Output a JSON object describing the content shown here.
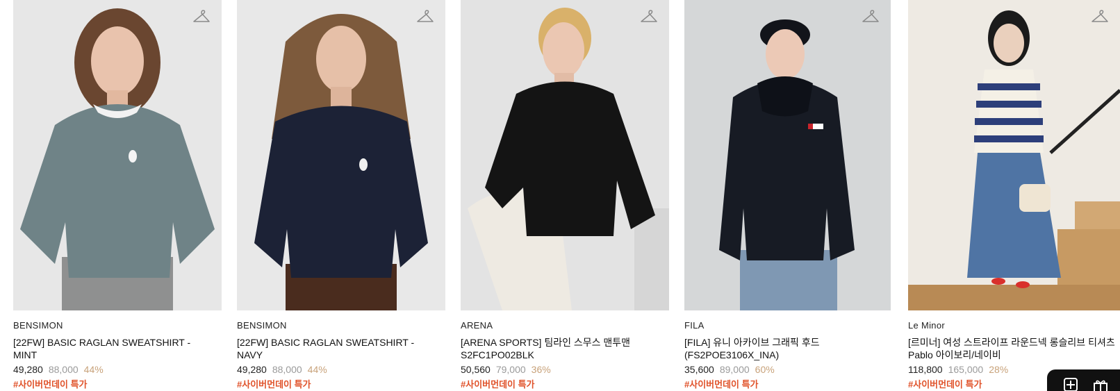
{
  "products": [
    {
      "brand": "BENSIMON",
      "name_line1": "[22FW] BASIC RAGLAN SWEATSHIRT -",
      "name_line2": "MINT",
      "price": "49,280",
      "original_price": "88,000",
      "discount": "44%",
      "tag": "#사이버먼데이 특가",
      "garment_color": "#6f8387"
    },
    {
      "brand": "BENSIMON",
      "name_line1": "[22FW] BASIC RAGLAN SWEATSHIRT -",
      "name_line2": "NAVY",
      "price": "49,280",
      "original_price": "88,000",
      "discount": "44%",
      "tag": "#사이버먼데이 특가",
      "garment_color": "#1c2236"
    },
    {
      "brand": "ARENA",
      "name_line1": "[ARENA SPORTS] 팀라인 스무스 맨투맨",
      "name_line2": "S2FC1PO02BLK",
      "price": "50,560",
      "original_price": "79,000",
      "discount": "36%",
      "tag": "#사이버먼데이 특가",
      "garment_color": "#141414"
    },
    {
      "brand": "FILA",
      "name_line1": "[FILA] 유니 아카이브 그래픽 후드",
      "name_line2": "(FS2POE3106X_INA)",
      "price": "35,600",
      "original_price": "89,000",
      "discount": "60%",
      "tag": "#사이버먼데이 특가",
      "garment_color": "#171b24"
    },
    {
      "brand": "Le Minor",
      "name_line1": "[르미너] 여성 스트라이프 라운드넥 롱슬리브 티셔츠",
      "name_line2": "Pablo 아이보리/네이비",
      "price": "118,800",
      "original_price": "165,000",
      "discount": "28%",
      "tag": "#사이버먼데이 특가",
      "garment_color": "#2d3f7a"
    }
  ],
  "icons": {
    "wishlist": "hanger-icon",
    "floating_left": "plus-square-icon",
    "floating_right": "gift-icon"
  },
  "colors": {
    "tag": "#e0522a",
    "discount": "#c8a27a",
    "original_price": "#9a9a9a"
  }
}
